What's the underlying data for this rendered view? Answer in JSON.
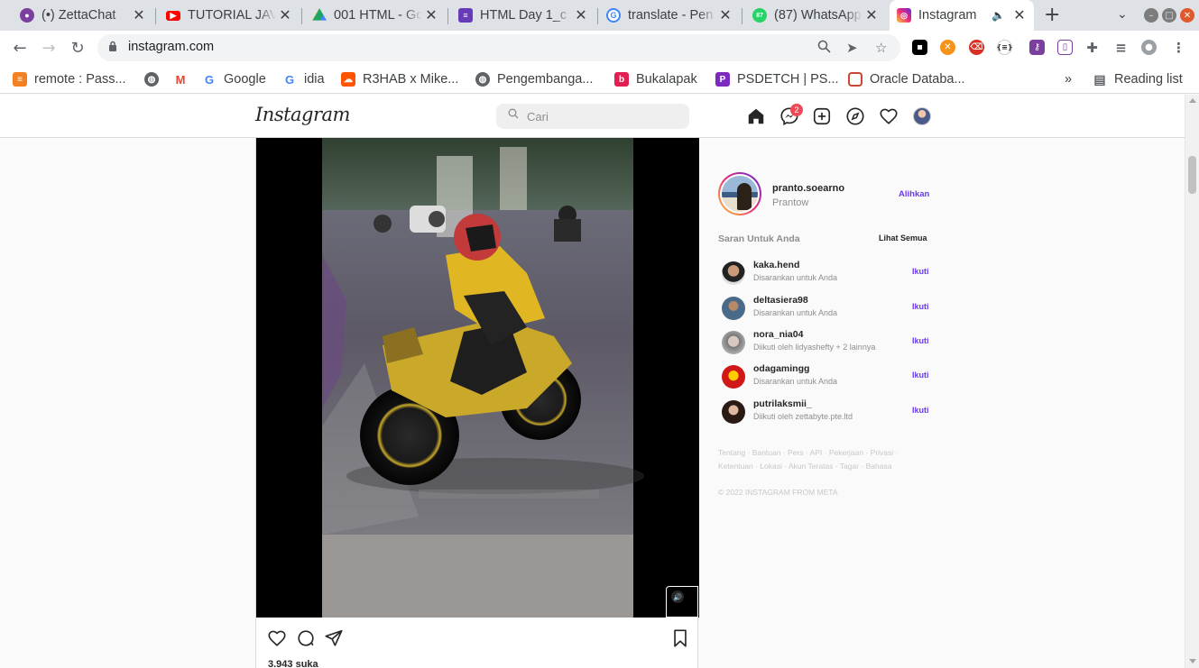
{
  "browser": {
    "tabs": [
      {
        "label": "(•) ZettaChat",
        "icon": "zettachat-icon",
        "color": "#7b3fa0"
      },
      {
        "label": "TUTORIAL JAVA",
        "icon": "youtube-icon",
        "color": "#ff0000"
      },
      {
        "label": "001 HTML - Go",
        "icon": "google-drive-icon",
        "color": "#1fa463"
      },
      {
        "label": "HTML Day 1_c",
        "icon": "google-forms-icon",
        "color": "#673ab7"
      },
      {
        "label": "translate - Pen",
        "icon": "google-icon",
        "color": "#4285f4"
      },
      {
        "label": "(87) WhatsApp",
        "icon": "whatsapp-icon",
        "color": "#25d366"
      },
      {
        "label": "Instagram",
        "icon": "instagram-icon",
        "color": "#c13584",
        "active": true
      }
    ],
    "tab_close_glyph": "✕",
    "new_tab_glyph": "+",
    "url": "instagram.com",
    "bookmarks": [
      {
        "label": "remote : Pass...",
        "icon": "stackoverflow-icon",
        "color": "#f48024"
      },
      {
        "label": "",
        "icon": "globe-icon",
        "color": "#5f6368"
      },
      {
        "label": "",
        "icon": "gmail-icon",
        "color": "#ea4335"
      },
      {
        "label": "Google",
        "icon": "google-icon",
        "color": "#4285f4"
      },
      {
        "label": "idia",
        "icon": "google-icon",
        "color": "#4285f4"
      },
      {
        "label": "R3HAB x Mike...",
        "icon": "soundcloud-icon",
        "color": "#ff5500"
      },
      {
        "label": "Pengembanga...",
        "icon": "globe-icon",
        "color": "#5f6368"
      },
      {
        "label": "Bukalapak",
        "icon": "bukalapak-icon",
        "color": "#e31e52"
      },
      {
        "label": "PSDETCH | PS...",
        "icon": "psdetch-icon",
        "color": "#7b2cbf"
      },
      {
        "label": "Oracle Databa...",
        "icon": "oracle-icon",
        "color": "#c74634"
      }
    ],
    "bookmarks_overflow": "»",
    "reading_list": "Reading list"
  },
  "instagram": {
    "logo": "Instagram",
    "search_placeholder": "Cari",
    "messenger_badge": "2",
    "accent": "#6a3aed",
    "post": {
      "likes": "3.943 suka"
    },
    "profile": {
      "username": "pranto.soearno",
      "name": "Prantow",
      "switch_label": "Alihkan"
    },
    "suggestions_title": "Saran Untuk Anda",
    "see_all": "Lihat Semua",
    "suggestions": [
      {
        "username": "kaka.hend",
        "reason": "Disarankan untuk Anda",
        "follow": "Ikuti"
      },
      {
        "username": "deltasiera98",
        "reason": "Disarankan untuk Anda",
        "follow": "Ikuti"
      },
      {
        "username": "nora_nia04",
        "reason": "Diikuti oleh lidyashefty + 2 lainnya",
        "follow": "Ikuti"
      },
      {
        "username": "odagamingg",
        "reason": "Disarankan untuk Anda",
        "follow": "Ikuti"
      },
      {
        "username": "putrilaksmii_",
        "reason": "Diikuti oleh zettabyte.pte.ltd",
        "follow": "Ikuti"
      }
    ],
    "footer_links": "Tentang · Bantuan · Pers · API · Pekerjaan · Privasi · Ketentuan · Lokasi · Akun Teratas · Tagar · Bahasa",
    "copyright": "© 2022 INSTAGRAM FROM META"
  }
}
